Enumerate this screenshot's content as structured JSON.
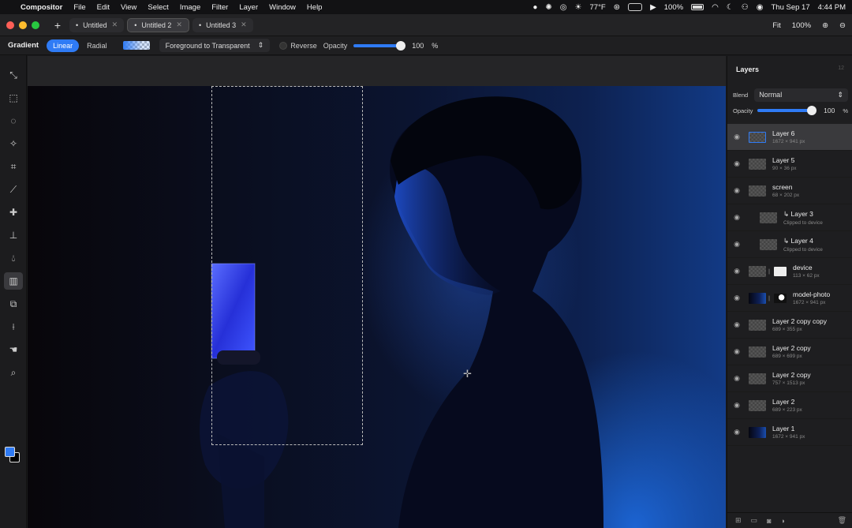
{
  "menubar": {
    "app": "Compositor",
    "items": [
      "File",
      "Edit",
      "View",
      "Select",
      "Image",
      "Filter",
      "Layer",
      "Window",
      "Help"
    ],
    "temperature": "77°F",
    "battery": "100%",
    "datetime_day": "Thu Sep 17",
    "datetime_time": "4:44 PM"
  },
  "tabs": [
    {
      "label": "Untitled",
      "active": false
    },
    {
      "label": "Untitled 2",
      "active": true
    },
    {
      "label": "Untitled 3",
      "active": false
    }
  ],
  "view": {
    "fit_label": "Fit",
    "zoom": "100%"
  },
  "options": {
    "tool": "Gradient",
    "modes": [
      "Linear",
      "Radial"
    ],
    "active_mode": "Linear",
    "preset": "Foreground to Transparent",
    "reverse_label": "Reverse",
    "opacity_label": "Opacity",
    "opacity_value": "100",
    "opacity_unit": "%",
    "opacity_level": 1.0
  },
  "colors": {
    "accent": "#2f7bf5",
    "foreground": "#2f7bf5",
    "background": "#000000"
  },
  "layers_panel": {
    "title": "Layers",
    "count": "12",
    "blend_label": "Blend",
    "blend_value": "Normal",
    "opacity_label": "Opacity",
    "opacity_value": "100",
    "opacity_unit": "%",
    "layers": [
      {
        "name": "Layer 6",
        "detail": "1672 × 941 px",
        "selected": true
      },
      {
        "name": "Layer 5",
        "detail": "90 × 36 px"
      },
      {
        "name": "screen",
        "detail": "68 × 202 px"
      },
      {
        "name": "Layer 3",
        "detail": "Clipped to device",
        "clipped": true
      },
      {
        "name": "Layer 4",
        "detail": "Clipped to device",
        "clipped": true
      },
      {
        "name": "device",
        "detail": "113 × 62 px",
        "mask": true
      },
      {
        "name": "model-photo",
        "detail": "1672 × 941 px",
        "mask": true,
        "photo": true
      },
      {
        "name": "Layer 2 copy copy",
        "detail": "689 × 355 px"
      },
      {
        "name": "Layer 2 copy",
        "detail": "689 × 699 px"
      },
      {
        "name": "Layer 2 copy",
        "detail": "757 × 1513 px"
      },
      {
        "name": "Layer 2",
        "detail": "689 × 223 px"
      },
      {
        "name": "Layer 1",
        "detail": "1672 × 941 px",
        "photo": true
      }
    ]
  }
}
